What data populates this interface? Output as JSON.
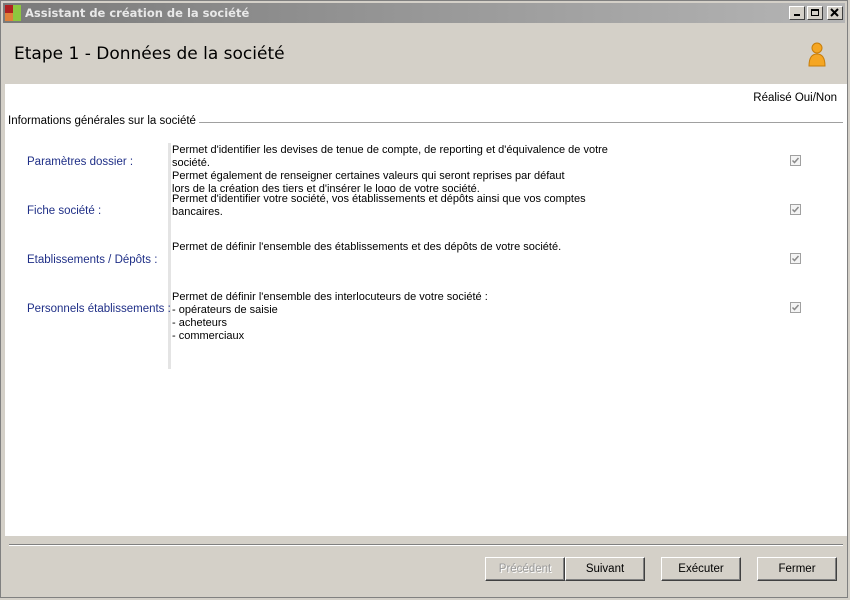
{
  "window": {
    "title": "Assistant de création de la société"
  },
  "header": {
    "step_title": "Etape 1 - Données de la société"
  },
  "content": {
    "done_column_label": "Réalisé Oui/Non",
    "group_label": "Informations générales sur la société",
    "rows": [
      {
        "label": "Paramètres dossier :",
        "description": [
          "Permet d'identifier les devises de tenue de compte, de reporting et d'équivalence de votre",
          "société.",
          "Permet également de renseigner certaines valeurs qui seront reprises par défaut",
          "lors de la création des tiers et d'insérer le logo de votre société."
        ],
        "checked": true
      },
      {
        "label": "Fiche société :",
        "description": [
          "Permet d'identifier votre société, vos établissements et dépôts ainsi que vos comptes",
          "bancaires."
        ],
        "checked": true
      },
      {
        "label": "Etablissements / Dépôts :",
        "description": [
          "Permet de définir l'ensemble des établissements et des dépôts de votre société."
        ],
        "checked": true
      },
      {
        "label": "Personnels établissements :",
        "description": [
          "Permet de définir l'ensemble des interlocuteurs de votre société :",
          "- opérateurs de saisie",
          "- acheteurs",
          "- commerciaux"
        ],
        "checked": true
      }
    ]
  },
  "buttons": {
    "previous": "Précédent",
    "next": "Suivant",
    "execute": "Exécuter",
    "close": "Fermer"
  },
  "colors": {
    "row_label": "#1f2f87",
    "titlebar_start": "#7a7a7a",
    "titlebar_end": "#b5b5b5"
  }
}
